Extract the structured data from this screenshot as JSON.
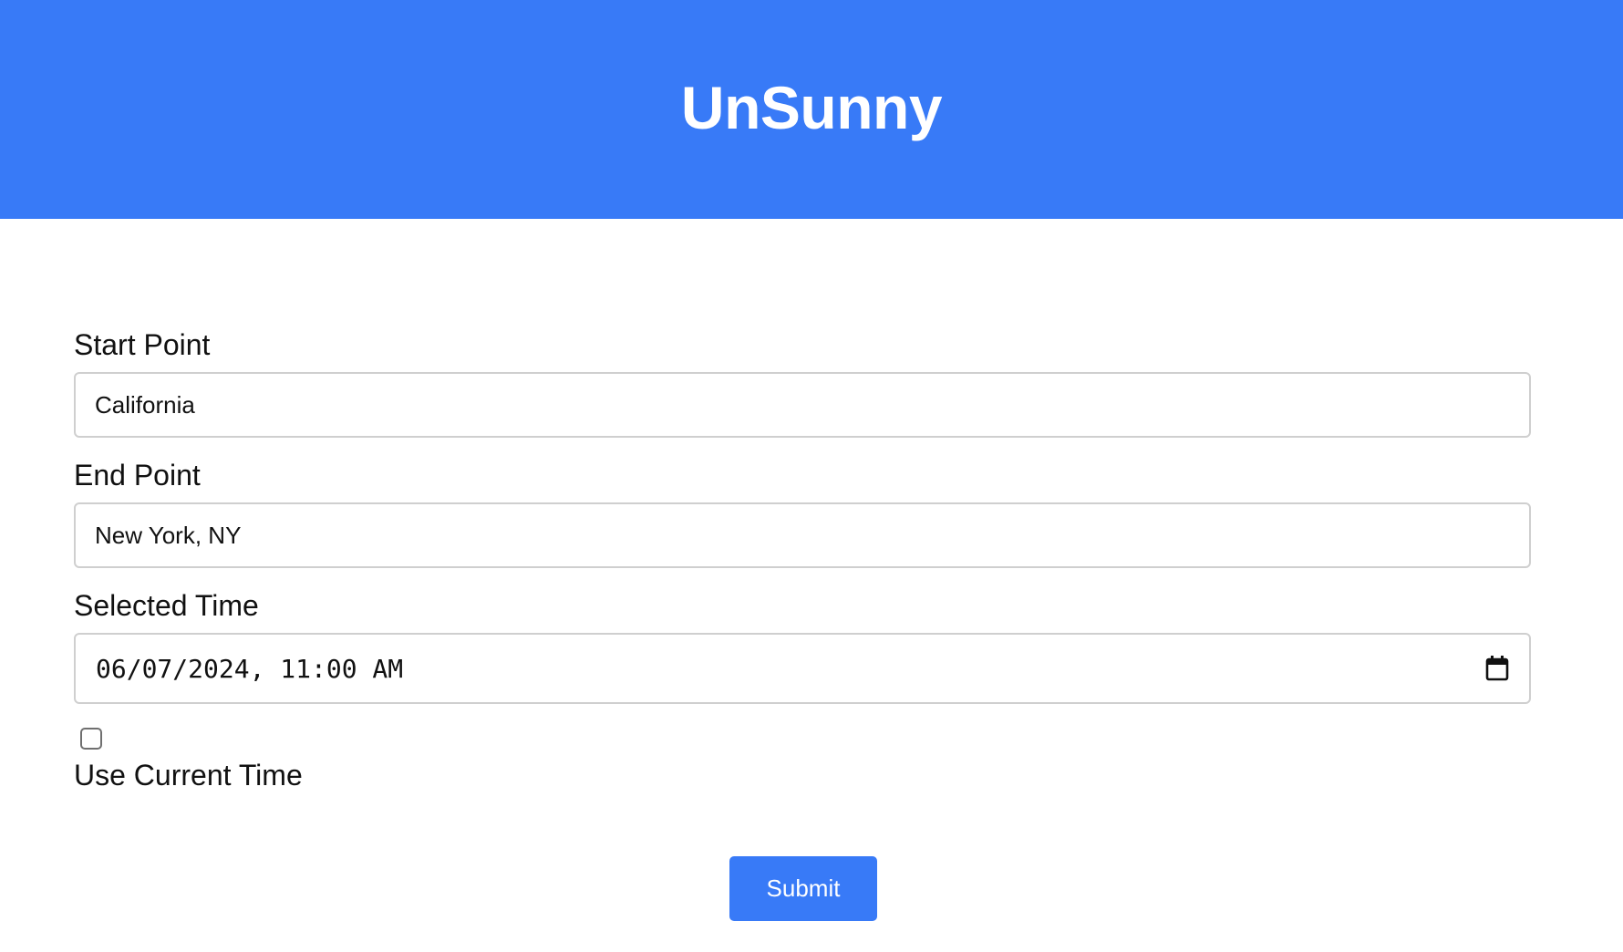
{
  "header": {
    "title": "UnSunny"
  },
  "form": {
    "start_point": {
      "label": "Start Point",
      "value": "California"
    },
    "end_point": {
      "label": "End Point",
      "value": "New York, NY"
    },
    "selected_time": {
      "label": "Selected Time",
      "value": "06/07/2024, 11:00 AM",
      "icon": "calendar-icon"
    },
    "use_current_time": {
      "label": "Use Current Time",
      "checked": false
    },
    "submit_label": "Submit"
  },
  "colors": {
    "accent": "#387af7",
    "text": "#111111",
    "input_border": "#cfcfcf"
  }
}
